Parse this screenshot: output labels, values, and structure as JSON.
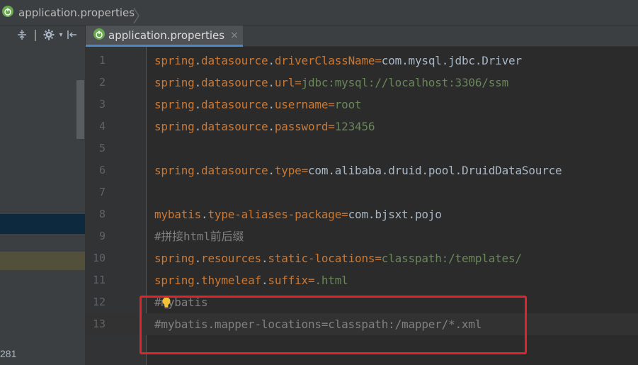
{
  "breadcrumb": {
    "file": "application.properties"
  },
  "tab": {
    "label": "application.properties",
    "close_glyph": "×"
  },
  "left_panel": {
    "status_count": "281"
  },
  "icons": {
    "leaf": "spring-leaf-icon",
    "collapse": "collapse-icon",
    "settings": "gear-icon",
    "hide": "hide-panel-icon",
    "bulb": "lightbulb-icon"
  },
  "colors": {
    "accent_tab": "#4a88c7",
    "highlight_box": "#e0242a",
    "key": "#cc7832",
    "value": "#6a8759",
    "comment": "#808080"
  },
  "lines": [
    {
      "n": "1",
      "key": "spring.datasource.driverClassName",
      "value": "com.mysql.jdbc.Driver"
    },
    {
      "n": "2",
      "key": "spring.datasource.url",
      "value": "jdbc:mysql://localhost:3306/ssm"
    },
    {
      "n": "3",
      "key": "spring.datasource.username",
      "value": "root"
    },
    {
      "n": "4",
      "key": "spring.datasource.password",
      "value": "123456"
    },
    {
      "n": "5",
      "text": ""
    },
    {
      "n": "6",
      "key": "spring.datasource.type",
      "value": "com.alibaba.druid.pool.DruidDataSource"
    },
    {
      "n": "7",
      "text": ""
    },
    {
      "n": "8",
      "key": "mybatis.type-aliases-package",
      "value": "com.bjsxt.pojo"
    },
    {
      "n": "9",
      "comment": "#拼接html前后缀"
    },
    {
      "n": "10",
      "key": "spring.resources.static-locations",
      "value": "classpath:/templates/"
    },
    {
      "n": "11",
      "key": "spring.thymeleaf.suffix",
      "value": ".html"
    },
    {
      "n": "12",
      "comment": "#mybatis"
    },
    {
      "n": "13",
      "comment": "#mybatis.mapper-locations=classpath:/mapper/*.xml"
    }
  ]
}
